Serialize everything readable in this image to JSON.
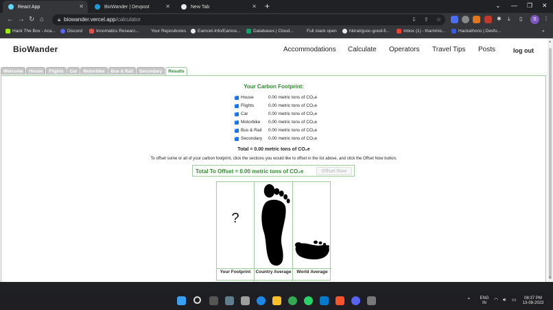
{
  "browser": {
    "tabs": [
      {
        "title": "React App",
        "active": true
      },
      {
        "title": "BioWander | Devpost",
        "active": false
      },
      {
        "title": "New Tab",
        "active": false
      }
    ],
    "url_domain": "biowander.vercel.app",
    "url_path": "/calculator",
    "bookmarks": [
      "Hack The Box - Aca...",
      "Discord",
      "Innomatics Researc...",
      "Your Repositories",
      "Eamcet-Info/Eamce...",
      "Databases | Cloud...",
      "Full stack open",
      "hkirat/gsoc-good-fi...",
      "Inbox (1) - thammis...",
      "Hackathons | Devfo..."
    ],
    "profile_initial": "S"
  },
  "site": {
    "logo": "BioWander",
    "nav": [
      "Accommodations",
      "Calculate",
      "Operators",
      "Travel Tips",
      "Posts"
    ],
    "logout": "log out"
  },
  "calculator": {
    "tabs": [
      "Welcome",
      "House",
      "Flights",
      "Car",
      "Motorbike",
      "Bus & Rail",
      "Secondary",
      "Results"
    ],
    "active_tab": "Results",
    "title": "Your Carbon Footprint:",
    "rows": [
      {
        "label": "House",
        "value": "0.00 metric tons of CO₂e"
      },
      {
        "label": "Flights",
        "value": "0.00 metric tons of CO₂e"
      },
      {
        "label": "Car",
        "value": "0.00 metric tons of CO₂e"
      },
      {
        "label": "Motorbike",
        "value": "0.00 metric tons of CO₂e"
      },
      {
        "label": "Bus & Rail",
        "value": "0.00 metric tons of CO₂e"
      },
      {
        "label": "Secondary",
        "value": "0.00 metric tons of CO₂e"
      }
    ],
    "total": "Total = 0.00 metric tons of CO₂e",
    "instructions": "To offset some or all of your carbon footprint, click the sections you would like to offset in the list above, and click the Offset Now button.",
    "offset_total": "Total To Offset = 0.00 metric tons of CO₂e",
    "offset_button": "Offset Now",
    "comparison": {
      "unknown_mark": "?",
      "labels": [
        "Your Footprint",
        "Country Average",
        "World Average"
      ]
    }
  },
  "taskbar": {
    "lang_line1": "ENG",
    "lang_line2": "IN",
    "time": "08:37 PM",
    "date": "13-08-2023"
  }
}
